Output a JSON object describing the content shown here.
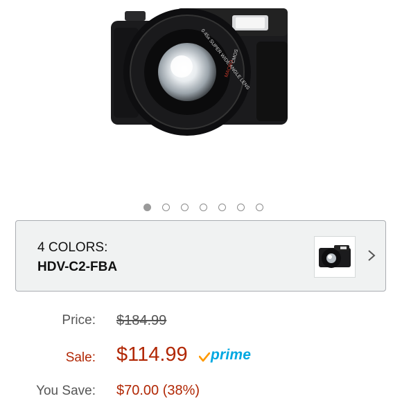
{
  "product": {
    "image_icon": "camera-with-wide-angle-lens",
    "lens_text": "0.45x SUPER WIDE ANGLE LENS",
    "macro_text": "MACRO",
    "sensor_text": "CMOS",
    "carousel": {
      "count": 7,
      "active": 1
    }
  },
  "variation": {
    "colors_label": "4 COLORS:",
    "model": "HDV-C2-FBA",
    "thumbnail_icon": "camera-thumbnail",
    "chevron_icon": "chevron-right-icon"
  },
  "pricing": {
    "price_label": "Price:",
    "list_price": "$184.99",
    "sale_label": "Sale:",
    "sale_price": "$114.99",
    "prime_label": "prime",
    "save_label": "You Save:",
    "save_amount": "$70.00 (38%)"
  },
  "colors": {
    "sale_red": "#b12704",
    "prime_blue": "#00a8e1",
    "prime_check": "#ff9900",
    "box_bg": "#f0f2f2"
  }
}
